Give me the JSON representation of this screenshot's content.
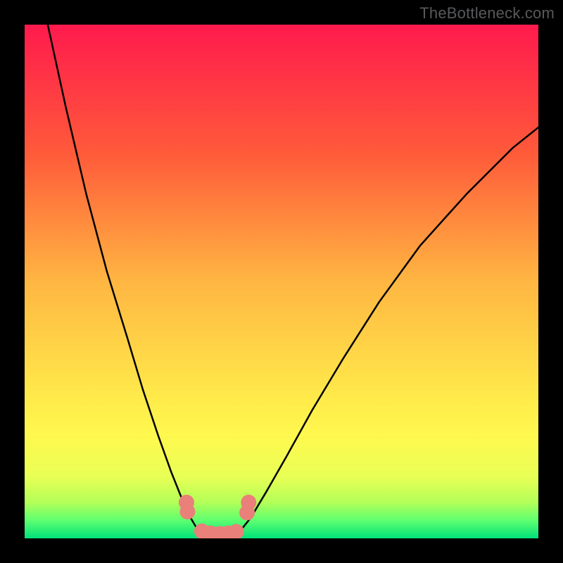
{
  "watermark": "TheBottleneck.com",
  "chart_data": {
    "type": "line",
    "title": "",
    "xlabel": "",
    "ylabel": "",
    "xlim": [
      0,
      100
    ],
    "ylim": [
      0,
      100
    ],
    "grid": false,
    "legend": false,
    "background_gradient_stops": [
      {
        "pos": 0.0,
        "color": "#ff1a4d"
      },
      {
        "pos": 0.25,
        "color": "#ff5a3a"
      },
      {
        "pos": 0.5,
        "color": "#ffb642"
      },
      {
        "pos": 0.72,
        "color": "#ffe94a"
      },
      {
        "pos": 0.8,
        "color": "#fff84e"
      },
      {
        "pos": 0.88,
        "color": "#e9ff55"
      },
      {
        "pos": 0.93,
        "color": "#b3ff58"
      },
      {
        "pos": 0.965,
        "color": "#5eff70"
      },
      {
        "pos": 1.0,
        "color": "#00e27a"
      }
    ],
    "series": [
      {
        "name": "curve-left",
        "color": "#000000",
        "width": 2.5,
        "x": [
          4.5,
          8,
          12,
          16,
          20,
          23,
          26,
          28.5,
          30.5,
          32,
          33.8
        ],
        "y": [
          100,
          84,
          67,
          52,
          39,
          29,
          20,
          13,
          8,
          4.5,
          1.5
        ]
      },
      {
        "name": "curve-right",
        "color": "#000000",
        "width": 2.5,
        "x": [
          42,
          44,
          47,
          51,
          56,
          62,
          69,
          77,
          86,
          95,
          100
        ],
        "y": [
          1.5,
          4,
          9,
          16,
          25,
          35,
          46,
          57,
          67,
          76,
          80
        ]
      },
      {
        "name": "valley-floor",
        "color": "#000000",
        "width": 2.5,
        "x": [
          33.8,
          35.5,
          38,
          40,
          42
        ],
        "y": [
          1.5,
          0.6,
          0.4,
          0.6,
          1.5
        ]
      },
      {
        "name": "blob-group",
        "color": "#e98079",
        "type": "scatter",
        "x": [
          31.5,
          31.7,
          34.5,
          36.2,
          38.0,
          39.6,
          41.2,
          43.3,
          43.6
        ],
        "y": [
          7.0,
          5.2,
          1.4,
          1.0,
          0.9,
          1.0,
          1.3,
          5.0,
          7.0
        ],
        "r": [
          11,
          11,
          11,
          11,
          11,
          11,
          11,
          11,
          11
        ]
      }
    ]
  }
}
